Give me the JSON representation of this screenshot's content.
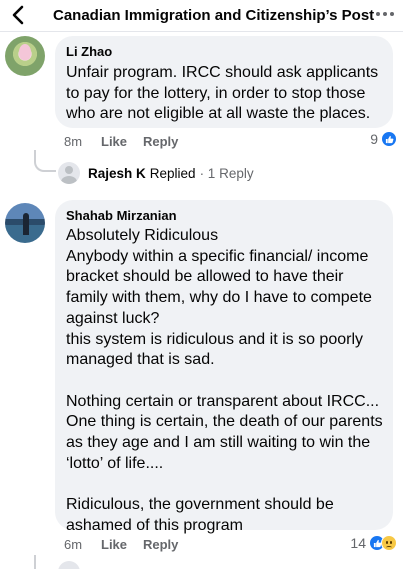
{
  "header": {
    "title": "Canadian Immigration and Citizenship’s Post",
    "back_icon": "chevron-left-icon",
    "more_icon": "more-horizontal-icon"
  },
  "comments": [
    {
      "author": "Li Zhao",
      "text": "Unfair program. IRCC should ask applicants to pay for the lottery, in order to stop those who are not eligible at all waste the places.",
      "time": "8m",
      "like_label": "Like",
      "reply_label": "Reply",
      "reaction_count": "9",
      "reactions": [
        "like-icon"
      ],
      "replies": {
        "name": "Rajesh K",
        "verb": "Replied",
        "count": "· 1 Reply"
      }
    },
    {
      "author": "Shahab Mirzanian",
      "text": "Absolutely Ridiculous\nAnybody within a specific financial/ income bracket should be allowed to have their family with them, why do I have to compete against luck?\nthis system is ridiculous and it is so poorly managed that is sad.\n\nNothing certain or transparent about IRCC... One thing is certain, the death of our parents as they age and I am still waiting to win the ‘lotto’ of life....\n\nRidiculous, the government should be ashamed of this program",
      "time": "6m",
      "like_label": "Like",
      "reply_label": "Reply",
      "reaction_count": "14",
      "reactions": [
        "like-icon",
        "sad-icon"
      ]
    }
  ],
  "colors": {
    "bubble": "#f0f2f5",
    "meta_text": "#65676b",
    "like_blue": "#1877f2",
    "sad_yellow": "#f7c845"
  }
}
